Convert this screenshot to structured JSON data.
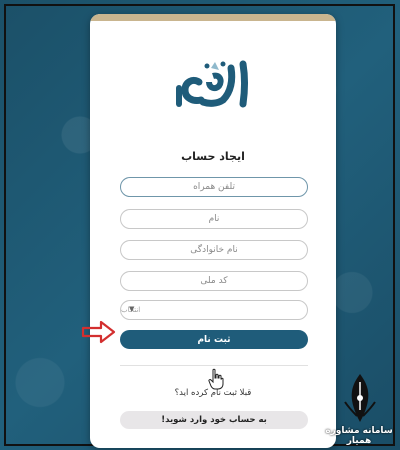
{
  "form": {
    "title": "ایجاد حساب",
    "fields": {
      "phone_placeholder": "تلفن همراه",
      "name_placeholder": "نام",
      "family_placeholder": "نام خانوادگی",
      "national_code_placeholder": "کد ملی",
      "select_placeholder": "انتخاب"
    },
    "submit_label": "ثبت نام",
    "already_registered": "قبلا ثبت نام کرده اید؟",
    "login_label": "به حساب خود وارد شوید!"
  },
  "icons": {
    "logo": "alefba-logo",
    "arrow": "red-arrow-icon",
    "cursor": "hand-cursor-icon",
    "caret": "caret-down-icon",
    "watermark": "pen-nib-logo"
  },
  "colors": {
    "primary": "#1f5c7a",
    "background": "#1d5470",
    "accent_bar": "#c9b58f",
    "arrow": "#d32f2f"
  },
  "watermark": {
    "text": "سامانه مشاوره همیار"
  }
}
